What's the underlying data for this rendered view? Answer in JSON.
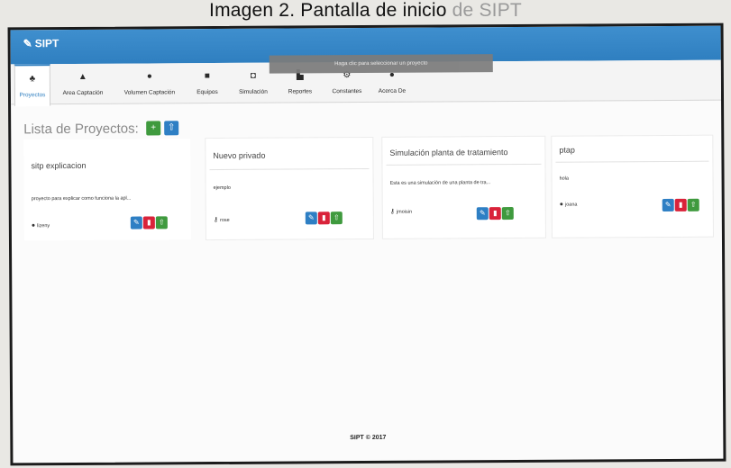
{
  "caption": {
    "text": "Imagen 2. Pantalla de inicio",
    "faded": " de SIPT"
  },
  "app": {
    "brand": "SIPT",
    "tooltip": "Haga clic para seleccionar un proyecto"
  },
  "tabs": [
    {
      "label": "Proyectos",
      "icon": "sitemap-icon",
      "glyph": "♣"
    },
    {
      "label": "Area Captación",
      "icon": "area-chart-icon",
      "glyph": "▲"
    },
    {
      "label": "Volumen Captación",
      "icon": "tint-icon",
      "glyph": "●"
    },
    {
      "label": "Equipos",
      "icon": "server-icon",
      "glyph": "■"
    },
    {
      "label": "Simulación",
      "icon": "play-icon",
      "glyph": "◘"
    },
    {
      "label": "Reportes",
      "icon": "file-icon",
      "glyph": "▙"
    },
    {
      "label": "Constantes",
      "icon": "gears-icon",
      "glyph": "⚙"
    },
    {
      "label": "Acerca De",
      "icon": "info-icon",
      "glyph": "●"
    }
  ],
  "page": {
    "title": "Lista de Proyectos:",
    "add_icon": "plus-icon",
    "upload_icon": "upload-icon"
  },
  "projects": [
    {
      "title": "sitp explicacion",
      "description": "proyecto para explicar como funciona la apl...",
      "owner": "lizeny"
    },
    {
      "title": "Nuevo privado",
      "description": "ejemplo",
      "owner": "rose"
    },
    {
      "title": "Simulación planta de tratamiento",
      "description": "Esta es una simulación de una planta de tra...",
      "owner": "jmoisin"
    },
    {
      "title": "ptap",
      "description": "hola",
      "owner": "joana"
    }
  ],
  "footer": "SIPT © 2017",
  "colors": {
    "primary": "#2f7fc0",
    "danger": "#d9233a",
    "success": "#3f9a3e"
  }
}
